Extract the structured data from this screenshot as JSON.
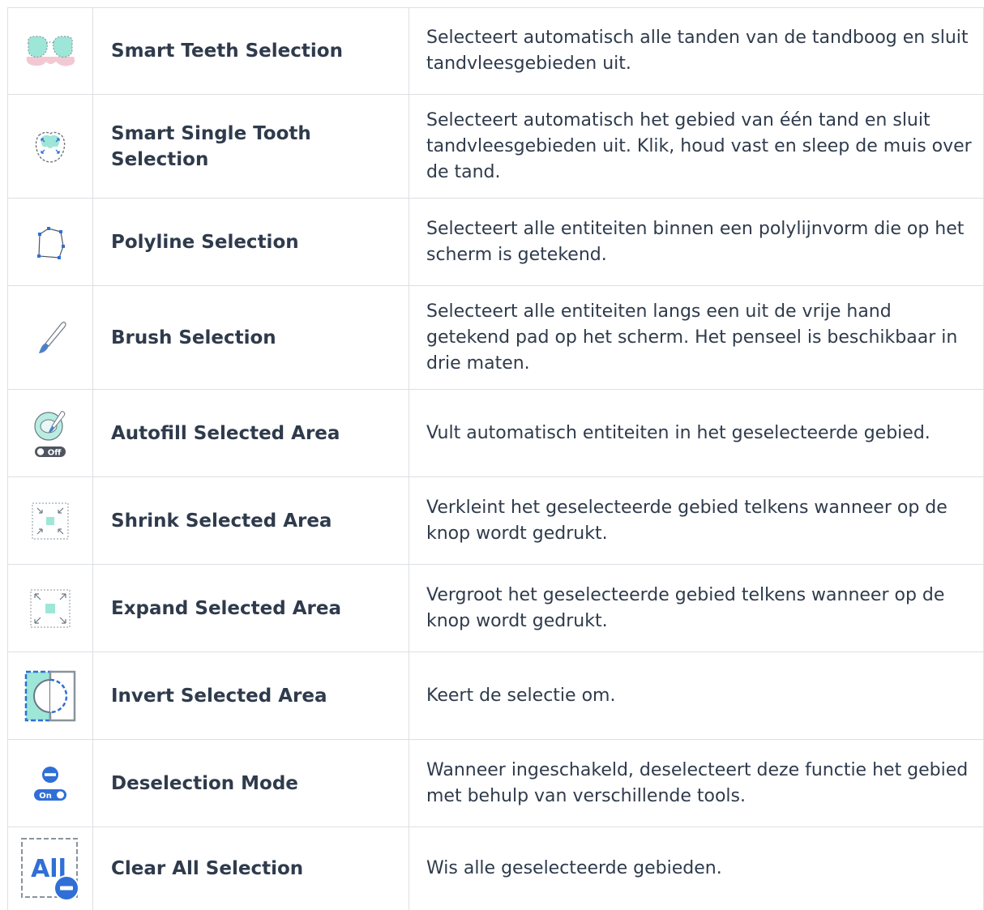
{
  "rows": [
    {
      "name": "Smart Teeth Selection",
      "description": "Selecteert automatisch alle tanden van de tandboog en sluit tandvleesgebieden uit.",
      "icon": "smart-teeth-selection-icon"
    },
    {
      "name": "Smart Single Tooth Selection",
      "description": "Selecteert automatisch het gebied van één tand en sluit tandvleesgebieden uit. Klik, houd vast en sleep de muis over de tand.",
      "icon": "single-tooth-selection-icon"
    },
    {
      "name": "Polyline Selection",
      "description": "Selecteert alle entiteiten binnen een polylijnvorm die op het scherm is getekend.",
      "icon": "polyline-selection-icon"
    },
    {
      "name": "Brush Selection",
      "description": "Selecteert alle entiteiten langs een uit de vrije hand getekend pad op het scherm. Het penseel is beschikbaar in drie maten.",
      "icon": "brush-icon"
    },
    {
      "name": "Autofill Selected Area",
      "description": "Vult automatisch entiteiten in het geselecteerde gebied.",
      "icon": "autofill-icon",
      "toggle_label": "Off"
    },
    {
      "name": "Shrink Selected Area",
      "description": "Verkleint het geselecteerde gebied telkens wanneer op de knop wordt gedrukt.",
      "icon": "shrink-icon"
    },
    {
      "name": "Expand Selected Area",
      "description": "Vergroot het geselecteerde gebied telkens wanneer op de knop wordt gedrukt.",
      "icon": "expand-icon"
    },
    {
      "name": "Invert Selected Area",
      "description": "Keert de selectie om.",
      "icon": "invert-icon"
    },
    {
      "name": "Deselection Mode",
      "description": "Wanneer ingeschakeld, deselecteert deze functie het gebied met behulp van verschillende tools.",
      "icon": "deselection-mode-icon",
      "toggle_label": "On"
    },
    {
      "name": "Clear All Selection",
      "description": "Wis alle geselecteerde gebieden.",
      "icon": "clear-all-icon",
      "icon_text": "All"
    }
  ],
  "colors": {
    "text": "#2f3b4c",
    "border": "#dcdfe4",
    "accent_blue": "#2f6fd6",
    "mint": "#9ee6d8",
    "pink": "#f2c9d2"
  }
}
